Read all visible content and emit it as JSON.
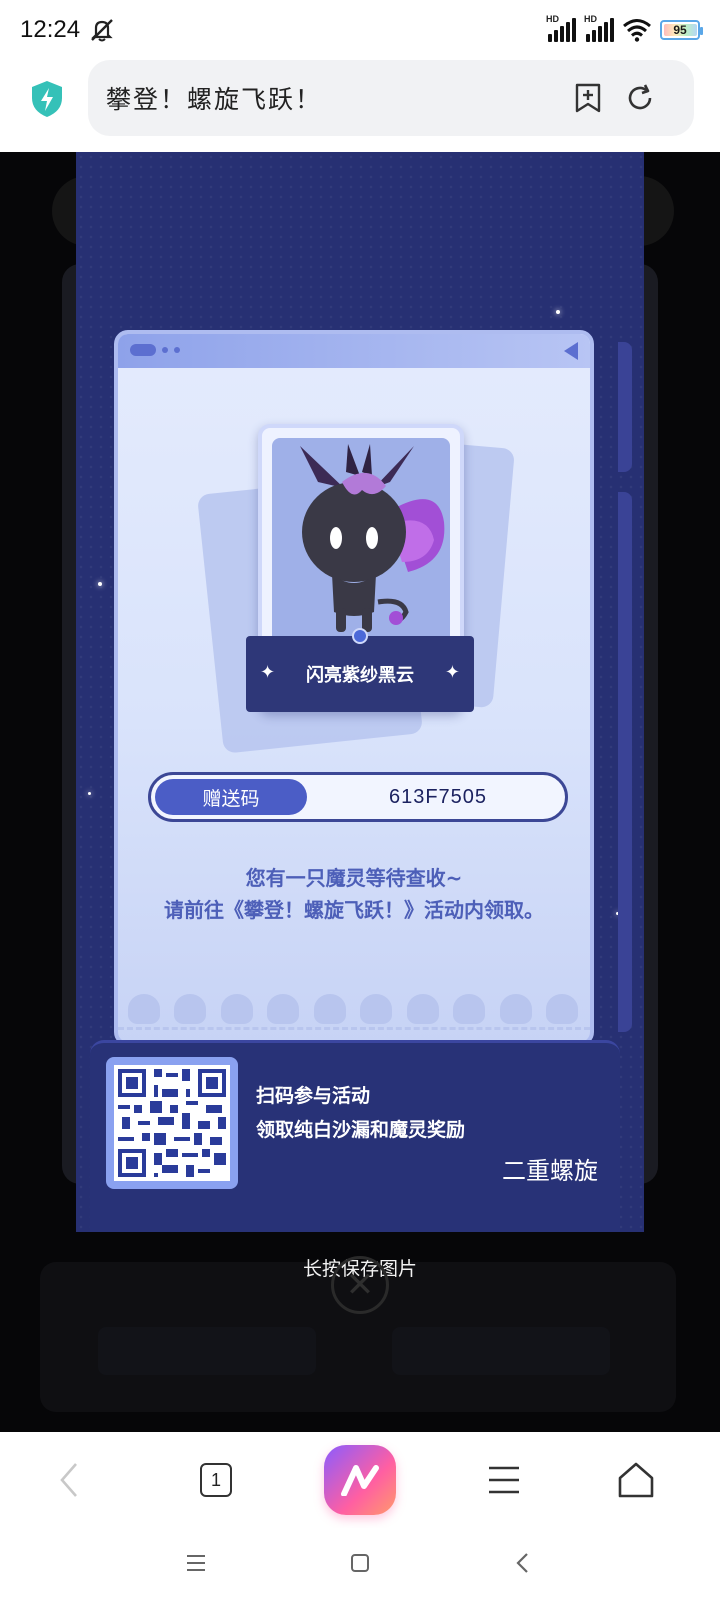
{
  "status_bar": {
    "time": "12:24",
    "signal_label_1": "HD",
    "signal_label_2": "HD",
    "battery": "95"
  },
  "address_bar": {
    "title": "攀登！螺旋飞跃！"
  },
  "card": {
    "pet_name": "闪亮紫纱黑云",
    "code_label": "赠送码",
    "code_value": "613F7505",
    "message_line1": "您有一只魔灵等待查收~",
    "message_line2": "请前往《攀登！螺旋飞跃！》活动内领取。"
  },
  "qr_panel": {
    "line1": "扫码参与活动",
    "line2": "领取纯白沙漏和魔灵奖励",
    "logo": "二重螺旋"
  },
  "overlay": {
    "hint": "长按保存图片"
  },
  "bottom_nav": {
    "tab_count": "1"
  }
}
